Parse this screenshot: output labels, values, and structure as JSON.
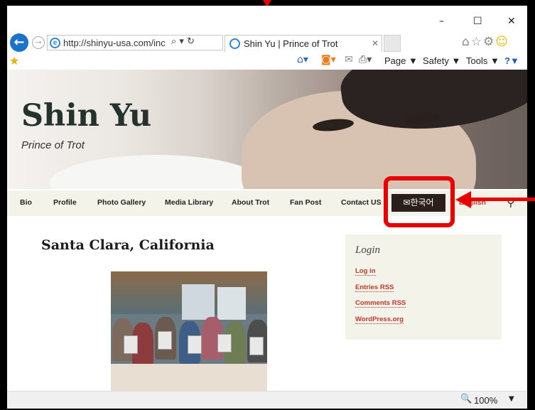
{
  "browser": {
    "window_controls": {
      "minimize": "–",
      "maximize": "☐",
      "close": "✕"
    },
    "address_bar": {
      "url": "http://shinyu-usa.com/inc",
      "icons": "⌕ ▾ ↻"
    },
    "tab": {
      "title": "Shin Yu | Prince of Trot",
      "close": "✕"
    },
    "command_bar": {
      "page_label": "Page ▼",
      "safety_label": "Safety ▼",
      "tools_label": "Tools ▼",
      "help_label": "?▼"
    }
  },
  "site": {
    "title": "Shin Yu",
    "tagline": "Prince of Trot",
    "menu": [
      "Bio",
      "Profile",
      "Photo Gallery",
      "Media Library",
      "About Trot",
      "Fan Post",
      "Contact US"
    ],
    "korean_menu_label": "✉한국어",
    "english_menu_label": "English"
  },
  "post": {
    "title": "Santa Clara, California"
  },
  "sidebar": {
    "widget_title": "Login",
    "links": [
      "Log in",
      "Entries RSS",
      "Comments RSS",
      "WordPress.org"
    ]
  },
  "statusbar": {
    "zoom": "100%"
  },
  "colors": {
    "annotation": "#e60000",
    "accent_link": "#c0392b",
    "ie_blue": "#1a73c9"
  }
}
